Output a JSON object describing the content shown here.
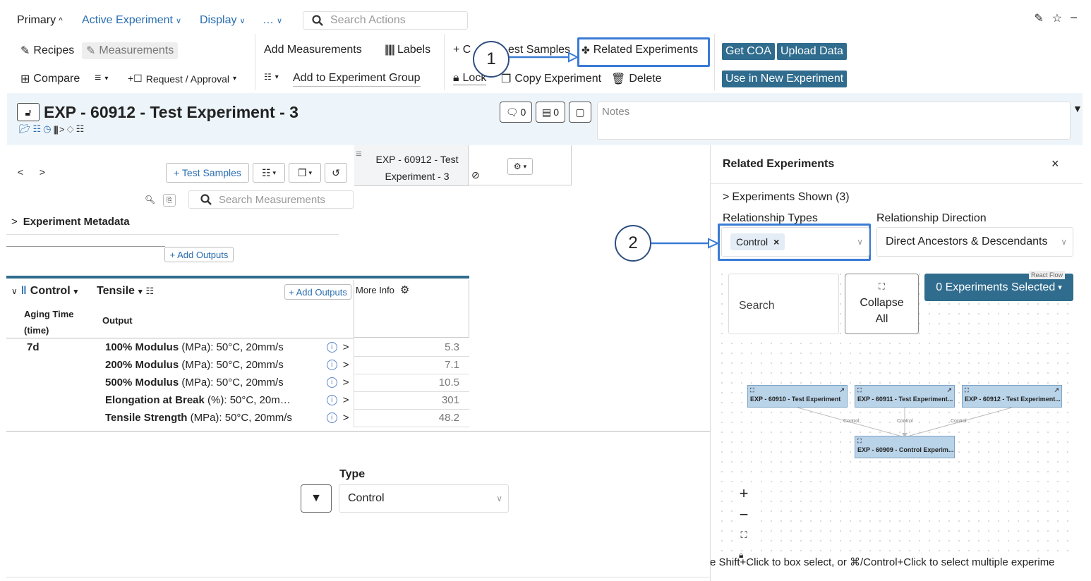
{
  "menu": {
    "primary": "Primary",
    "active_experiment": "Active Experiment",
    "display": "Display",
    "more": "…",
    "search_placeholder": "Search Actions"
  },
  "toolbar": {
    "recipes": "Recipes",
    "measurements": "Measurements",
    "compare": "Compare",
    "request_approval": "Request / Approval",
    "add_measurements": "Add Measurements",
    "labels": "Labels",
    "add_to_group": "Add to Experiment Group",
    "create_test_samples_left": "+ C",
    "create_test_samples_right": "est Samples",
    "related_experiments": "Related Experiments",
    "lock": "Lock",
    "copy_experiment": "Copy Experiment",
    "delete": "Delete",
    "get_coa": "Get COA",
    "upload_data": "Upload Data",
    "use_in_new": "Use in New Experiment"
  },
  "callouts": {
    "one": "1",
    "two": "2"
  },
  "header": {
    "title": "EXP - 60912 - Test Experiment - 3",
    "comments_count": "0",
    "tasks_count": "0",
    "notes_placeholder": "Notes"
  },
  "left": {
    "test_samples_btn": "+ Test Samples",
    "column_title": "EXP - 60912 - Test Experiment - 3",
    "search_measurements_placeholder": "Search Measurements",
    "experiment_metadata": "Experiment Metadata",
    "add_outputs": "+ Add Outputs",
    "control": "Control",
    "tensile": "Tensile",
    "add_outputs_2": "+ Add Outputs",
    "more_info": "More Info",
    "col_aging": "Aging Time (time)",
    "col_output": "Output",
    "aging_value": "7d",
    "rows": [
      {
        "name": "100% Modulus",
        "rest": " (MPa): 50°C, 20mm/s",
        "value": "5.3"
      },
      {
        "name": "200% Modulus",
        "rest": " (MPa): 50°C, 20mm/s",
        "value": "7.1"
      },
      {
        "name": "500% Modulus",
        "rest": " (MPa): 50°C, 20mm/s",
        "value": "10.5"
      },
      {
        "name": "Elongation at Break",
        "rest": " (%): 50°C, 20m…",
        "value": "301"
      },
      {
        "name": "Tensile Strength",
        "rest": " (MPa): 50°C, 20mm/s",
        "value": "48.2"
      }
    ],
    "type_label": "Type",
    "type_value": "Control"
  },
  "related": {
    "title": "Related Experiments",
    "experiments_shown": "Experiments Shown (3)",
    "relationship_types_label": "Relationship Types",
    "relationship_direction_label": "Relationship Direction",
    "type_chip": "Control",
    "direction_value": "Direct Ancestors & Descendants",
    "search_placeholder": "Search",
    "collapse_all": "Collapse All",
    "selected_btn": "0 Experiments Selected",
    "react_flow": "React Flow",
    "nodes": [
      {
        "label": "EXP - 60910 - Test Experiment"
      },
      {
        "label": "EXP - 60911 - Test Experiment..."
      },
      {
        "label": "EXP - 60912 - Test Experiment..."
      },
      {
        "label": "EXP - 60909 - Control Experim..."
      }
    ],
    "edge_label": "Control",
    "hint": "e Shift+Click to box select, or ⌘/Control+Click to select multiple experime"
  },
  "colors": {
    "accent": "#2a6db0",
    "dark_button": "#2f6c8e",
    "highlight": "#3a7bd5",
    "node": "#b9d3e8"
  }
}
